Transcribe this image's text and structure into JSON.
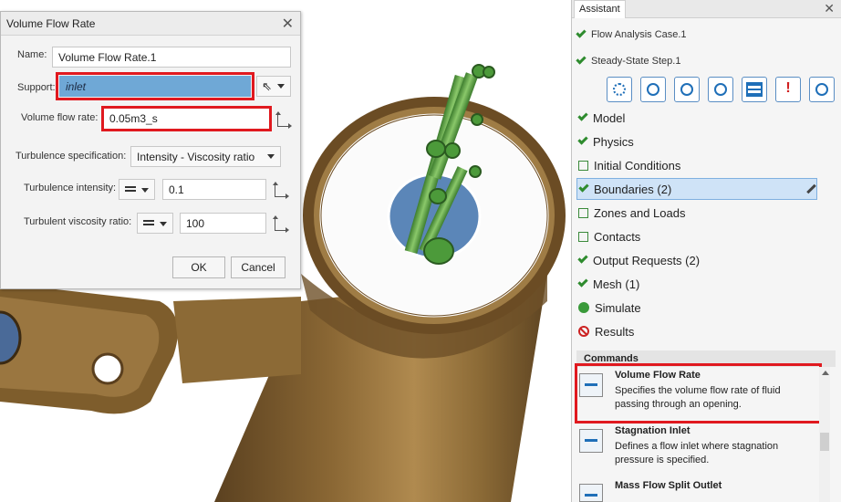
{
  "dialog": {
    "title": "Volume Flow Rate",
    "name_label": "Name:",
    "name_value": "Volume Flow Rate.1",
    "support_label": "Support:",
    "support_value": "inlet",
    "flow_label": "Volume flow rate:",
    "flow_value": "0.05m3_s",
    "turb_spec_label": "Turbulence specification:",
    "turb_spec_value": "Intensity - Viscosity ratio",
    "turb_intensity_label": "Turbulence intensity:",
    "turb_intensity_value": "0.1",
    "turb_visc_label": "Turbulent viscosity ratio:",
    "turb_visc_value": "100",
    "ok_label": "OK",
    "cancel_label": "Cancel"
  },
  "assistant": {
    "tab_label": "Assistant",
    "case_line": "Flow Analysis Case.1",
    "step_line": "Steady-State Step.1",
    "tree": [
      {
        "label": "Model",
        "state": "done"
      },
      {
        "label": "Physics",
        "state": "done"
      },
      {
        "label": "Initial Conditions",
        "state": "empty"
      },
      {
        "label": "Boundaries (2)",
        "state": "done"
      },
      {
        "label": "Zones and Loads",
        "state": "empty"
      },
      {
        "label": "Contacts",
        "state": "empty"
      },
      {
        "label": "Output Requests (2)",
        "state": "done"
      },
      {
        "label": "Mesh (1)",
        "state": "done"
      },
      {
        "label": "Simulate",
        "state": "running"
      },
      {
        "label": "Results",
        "state": "blocked"
      }
    ],
    "commands_header": "Commands",
    "commands": [
      {
        "title": "Volume Flow Rate",
        "desc": "Specifies the volume flow rate of fluid passing through an opening."
      },
      {
        "title": "Stagnation Inlet",
        "desc": "Defines a flow inlet where stagnation pressure is specified."
      },
      {
        "title": "Mass Flow Split Outlet",
        "desc": ""
      }
    ]
  },
  "colors": {
    "highlight_red": "#e0191f",
    "support_blue": "#6fa8d6",
    "pipe_brown": "#7a5a2e",
    "streamline_green": "#4c9a3a"
  }
}
